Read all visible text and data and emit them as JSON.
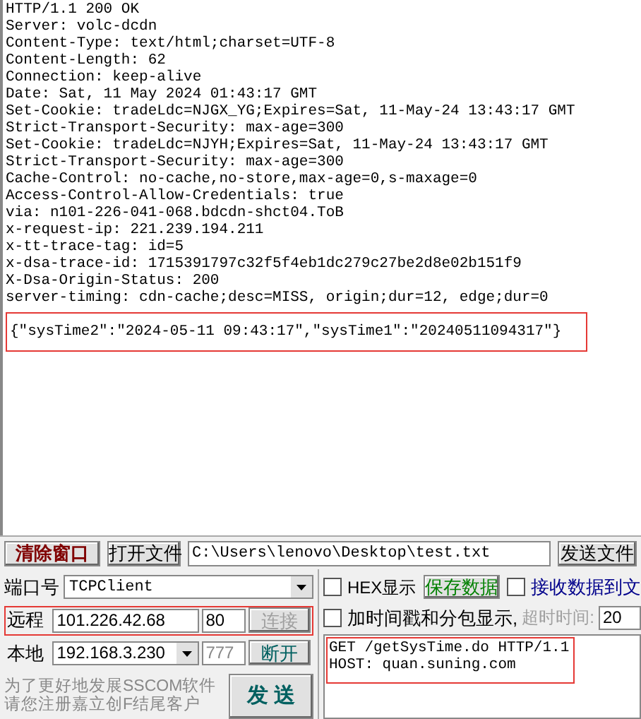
{
  "response_lines": [
    "HTTP/1.1 200 OK",
    "Server: volc-dcdn",
    "Content-Type: text/html;charset=UTF-8",
    "Content-Length: 62",
    "Connection: keep-alive",
    "Date: Sat, 11 May 2024 01:43:17 GMT",
    "Set-Cookie: tradeLdc=NJGX_YG;Expires=Sat, 11-May-24 13:43:17 GMT",
    "Strict-Transport-Security: max-age=300",
    "Set-Cookie: tradeLdc=NJYH;Expires=Sat, 11-May-24 13:43:17 GMT",
    "Strict-Transport-Security: max-age=300",
    "Cache-Control: no-cache,no-store,max-age=0,s-maxage=0",
    "Access-Control-Allow-Credentials: true",
    "via: n101-226-041-068.bdcdn-shct04.ToB",
    "x-request-ip: 221.239.194.211",
    "x-tt-trace-tag: id=5",
    "x-dsa-trace-id: 1715391797c32f5f4eb1dc279c27be2d8e02b151f9",
    "X-Dsa-Origin-Status: 200",
    "server-timing: cdn-cache;desc=MISS, origin;dur=12, edge;dur=0"
  ],
  "response_body": "{\"sysTime2\":\"2024-05-11 09:43:17\",\"sysTime1\":\"20240511094317\"}",
  "toolbar": {
    "clear_button": "清除窗口",
    "open_file_button": "打开文件",
    "file_path": "C:\\Users\\lenovo\\Desktop\\test.txt",
    "send_file_button": "发送文件"
  },
  "port": {
    "label": "端口号",
    "value": "TCPClient"
  },
  "remote": {
    "label": "远程",
    "ip": "101.226.42.68",
    "port": "80",
    "button": "连接",
    "button_disabled": true
  },
  "local": {
    "label": "本地",
    "ip": "192.168.3.230",
    "port": "777",
    "button": "断开",
    "button_disabled": false
  },
  "promo_lines": [
    "为了更好地发展SSCOM软件",
    "请您注册嘉立创F结尾客户"
  ],
  "send_button": "发 送",
  "options": [
    {
      "label": "HEX显示",
      "checked": false
    },
    {
      "label": "接收数据到文",
      "checked": false
    },
    {
      "label": "加时间戳和分包显示,",
      "checked": false
    }
  ],
  "save_button": "保存数据",
  "timeout": {
    "label": "超时时间:",
    "value": "20"
  },
  "send_lines": [
    "GET /getSysTime.do HTTP/1.1",
    "HOST: quan.suning.com"
  ]
}
